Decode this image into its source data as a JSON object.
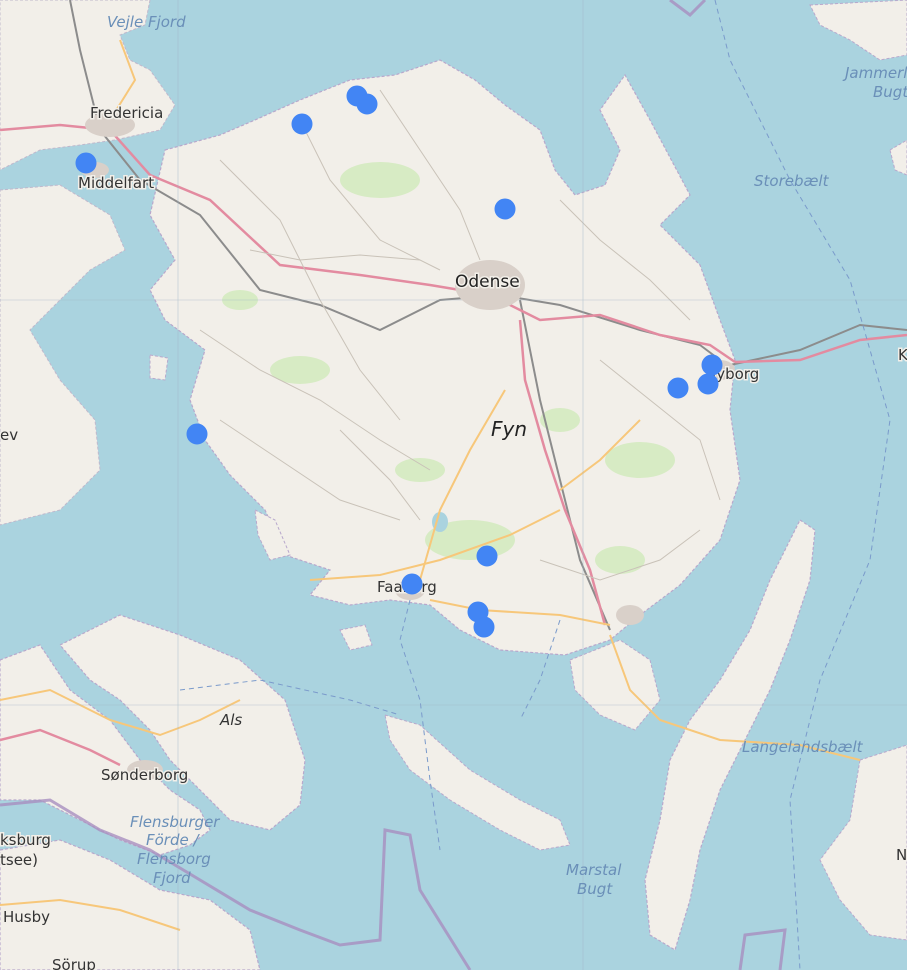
{
  "map": {
    "labels": {
      "vejle_fjord": "Vejle Fjord",
      "fredericia": "Fredericia",
      "middelfart": "Middelfart",
      "odense": "Odense",
      "fyn": "Fyn",
      "nyborg": "Nyborg",
      "storebaelt": "Storebælt",
      "jammerland_1": "Jammerl",
      "jammerland_2": "Bugt",
      "faaborg": "Faaborg",
      "als": "Als",
      "sonderborg": "Sønderborg",
      "flensburger_1": "Flensburger",
      "flensburger_2": "Förde /",
      "flensburger_3": "Flensborg",
      "flensburger_4": "Fjord",
      "marstal_1": "Marstal",
      "marstal_2": "Bugt",
      "langelandsbaelt": "Langelandsbælt",
      "ksburg": "ksburg",
      "tsee": "tsee)",
      "husby": "Husby",
      "sorup": "Sörup",
      "ev": "ev",
      "k": "K",
      "n": "N"
    },
    "colors": {
      "water": "#aad3df",
      "land": "#f2efe9",
      "forest": "#d7ebc4",
      "road_major": "#e38ba0",
      "road_secondary": "#f7c77a",
      "rail": "#8c8c8c",
      "border": "#a88fbf",
      "marker": "#4285f4"
    },
    "markers": [
      {
        "name": "marker-middelfart"
      },
      {
        "name": "marker-north-coast-1"
      },
      {
        "name": "marker-north-coast-2"
      },
      {
        "name": "marker-north-coast-3"
      },
      {
        "name": "marker-odense-fjord"
      },
      {
        "name": "marker-west-coast"
      },
      {
        "name": "marker-nyborg-1"
      },
      {
        "name": "marker-nyborg-2"
      },
      {
        "name": "marker-nyborg-3"
      },
      {
        "name": "marker-south-inland"
      },
      {
        "name": "marker-faaborg"
      },
      {
        "name": "marker-south-coast-1"
      },
      {
        "name": "marker-south-coast-2"
      }
    ]
  }
}
